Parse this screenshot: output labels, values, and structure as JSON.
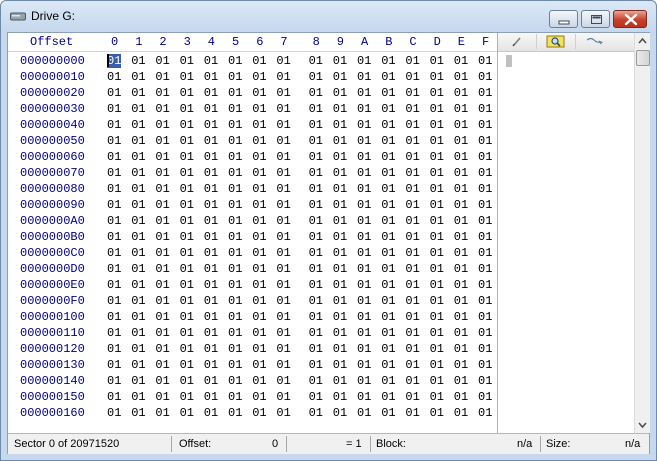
{
  "window": {
    "title": "Drive G:"
  },
  "hex_header": {
    "offset_label": "Offset",
    "columns": [
      "0",
      "1",
      "2",
      "3",
      "4",
      "5",
      "6",
      "7",
      "8",
      "9",
      "A",
      "B",
      "C",
      "D",
      "E",
      "F"
    ]
  },
  "offsets": [
    "000000000",
    "000000010",
    "000000020",
    "000000030",
    "000000040",
    "000000050",
    "000000060",
    "000000070",
    "000000080",
    "000000090",
    "0000000A0",
    "0000000B0",
    "0000000C0",
    "0000000D0",
    "0000000E0",
    "0000000F0",
    "000000100",
    "000000110",
    "000000120",
    "000000130",
    "000000140",
    "000000150",
    "000000160"
  ],
  "byte_value": "01",
  "selected_cell": {
    "row": 0,
    "col": 0
  },
  "side_toolbar": {
    "icons": [
      "pen-icon",
      "magnifier-icon",
      "wave-icon"
    ]
  },
  "status": {
    "sector": "Sector 0 of 20971520",
    "offset_label": "Offset:",
    "offset_value": "0",
    "eq_value": "= 1",
    "block_label": "Block:",
    "block_value": "n/a",
    "size_label": "Size:",
    "size_value": "n/a"
  }
}
